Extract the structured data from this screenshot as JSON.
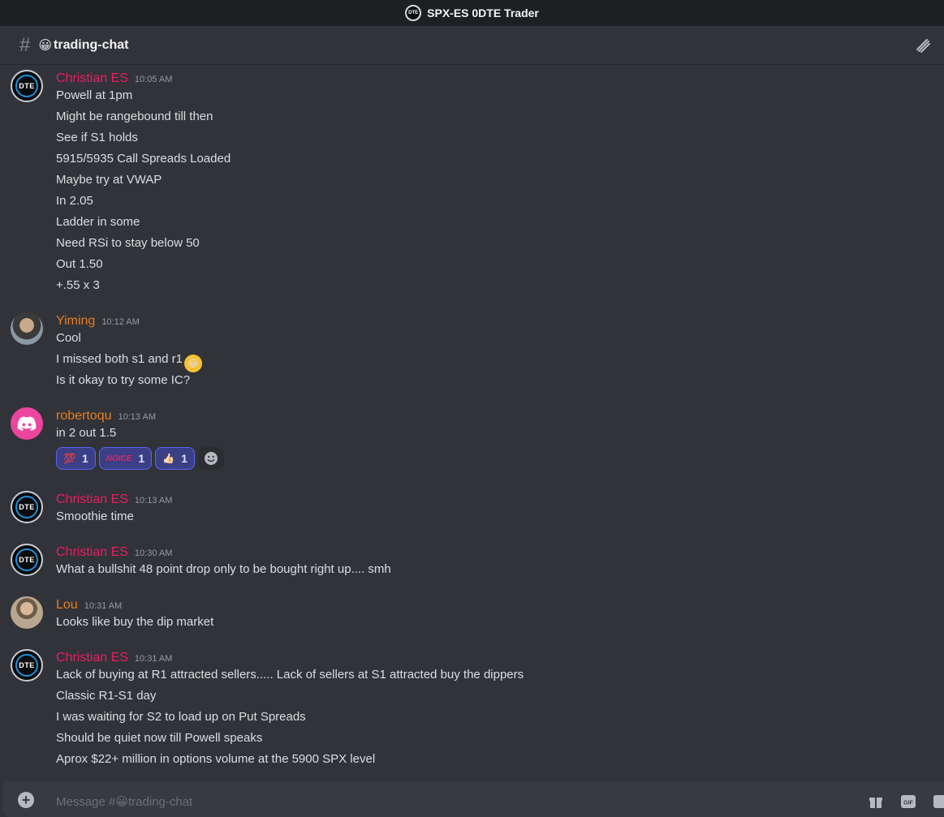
{
  "window": {
    "title": "SPX-ES 0DTE Trader"
  },
  "channel": {
    "hash": "#",
    "emoji": "😀",
    "name": "trading-chat"
  },
  "messages": [
    {
      "author": "Christian ES",
      "time": "10:05 AM",
      "lines": [
        "Powell at 1pm",
        "Might be rangebound till then",
        "See if S1 holds",
        "5915/5935 Call Spreads Loaded",
        "Maybe try at VWAP",
        "In 2.05",
        "Ladder in some",
        "Need RSi to stay below 50",
        "Out 1.50",
        "+.55 x 3"
      ]
    },
    {
      "author": "Yiming",
      "time": "10:12 AM",
      "lines": [
        "Cool",
        "I missed both s1 and r1",
        "Is it okay to try some IC?"
      ]
    },
    {
      "author": "robertoqu",
      "time": "10:13 AM",
      "lines": [
        "in 2 out 1.5"
      ],
      "reactions": [
        {
          "emoji": "💯",
          "count": "1"
        },
        {
          "emoji": "NOICE",
          "count": "1"
        },
        {
          "emoji": "👍🏻",
          "count": "1"
        }
      ]
    },
    {
      "author": "Christian ES",
      "time": "10:13 AM",
      "lines": [
        "Smoothie time"
      ]
    },
    {
      "author": "Christian ES",
      "time": "10:30 AM",
      "lines": [
        "What a bullshit 48 point drop only to be bought right up.... smh"
      ]
    },
    {
      "author": "Lou",
      "time": "10:31 AM",
      "lines": [
        "Looks like buy the dip market"
      ]
    },
    {
      "author": "Christian ES",
      "time": "10:31 AM",
      "lines": [
        "Lack of buying at R1 attracted sellers..... Lack of sellers at S1 attracted buy the dippers",
        "Classic R1-S1 day",
        "I was waiting for S2 to load up on Put Spreads",
        "Should be quiet now till Powell speaks",
        "Aprox $22+ million  in options volume at the 5900 SPX level"
      ]
    }
  ],
  "composer": {
    "placeholder_prefix": "Message #",
    "placeholder_emoji": "😀",
    "placeholder_channel": "trading-chat"
  },
  "avatars": {
    "dte_text": "DTE"
  },
  "colors": {
    "author_red": "#e91e63",
    "author_orange": "#e67e22",
    "reaction_bg": "#3b3f86",
    "reaction_border": "#5865f2"
  }
}
